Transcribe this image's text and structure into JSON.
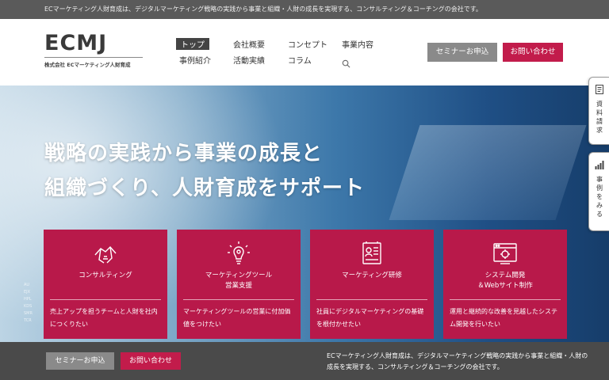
{
  "topbar": {
    "text": "ECマーケティング人財育成は、デジタルマーケティング戦略の実践から事業と組織・人財の成長を実現する、コンサルティング＆コーチングの会社です。"
  },
  "logo": {
    "main": "ECMJ",
    "sub": "株式会社 ECマーケティング人財育成"
  },
  "nav": {
    "items": [
      {
        "label": "トップ"
      },
      {
        "label": "会社概要"
      },
      {
        "label": "コンセプト"
      },
      {
        "label": "事業内容"
      },
      {
        "label": "事例紹介"
      },
      {
        "label": "活動実績"
      },
      {
        "label": "コラム"
      }
    ],
    "search_icon": "search-icon"
  },
  "header_buttons": {
    "seminar": "セミナーお申込",
    "contact": "お問い合わせ"
  },
  "hero": {
    "title_line1": "戦略の実践から事業の成長と",
    "title_line2": "組織づくり、人財育成をサポート",
    "chart_labels": [
      "AU",
      "EJX",
      "HPL",
      "KDS",
      "SMR",
      "TCR"
    ]
  },
  "cards": [
    {
      "icon": "handshake-icon",
      "title": [
        "コンサルティング"
      ],
      "desc": "売上アップを担うチームと人財を社内につくりたい"
    },
    {
      "icon": "lightbulb-gear-icon",
      "title": [
        "マーケティングツール",
        "営業支援"
      ],
      "desc": "マーケティングツールの営業に付加価値をつけたい"
    },
    {
      "icon": "training-board-icon",
      "title": [
        "マーケティング研修"
      ],
      "desc": "社員にデジタルマーケティングの基礎を根付かせたい"
    },
    {
      "icon": "web-system-icon",
      "title": [
        "システム開発",
        "＆Webサイト制作"
      ],
      "desc": "運用と継続的な改善を見越したシステム開発を行いたい"
    }
  ],
  "side_tabs": [
    {
      "icon": "document-icon",
      "label": [
        "資",
        "料",
        "請",
        "求"
      ]
    },
    {
      "icon": "bar-chart-icon",
      "label": [
        "事",
        "例",
        "を",
        "み",
        "る"
      ]
    }
  ],
  "footer": {
    "seminar": "セミナーお申込",
    "contact": "お問い合わせ",
    "text": "ECマーケティング人財育成は、デジタルマーケティング戦略の実践から事業と組織・人財の成長を実現する、コンサルティング＆コーチングの会社です。"
  },
  "colors": {
    "accent": "#c21c4b",
    "card": "#b8194a",
    "footer": "#4a4a4a",
    "topbar": "#5a5a5a",
    "gray_button": "#8a8a8a"
  }
}
